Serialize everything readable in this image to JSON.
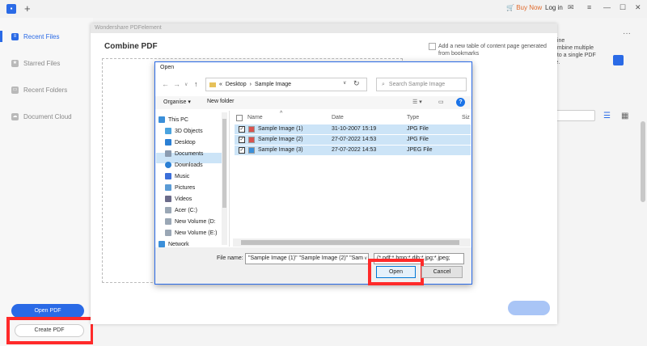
{
  "topbar": {
    "buy_now": "Buy Now",
    "login": "Log in"
  },
  "sidebar": {
    "items": [
      {
        "label": "Recent Files"
      },
      {
        "label": "Starred Files"
      },
      {
        "label": "Recent Folders"
      },
      {
        "label": "Document Cloud"
      }
    ],
    "open_pdf": "Open PDF",
    "create_pdf": "Create PDF"
  },
  "right_panel": {
    "card_text": "bine\nombine multiple\nnto a single PDF\nle."
  },
  "combine": {
    "window_title": "Wondershare PDFelement",
    "title": "Combine PDF",
    "option": "Add a new table of content page generated from bookmarks"
  },
  "open_dialog": {
    "title": "Open",
    "address": [
      "Desktop",
      "Sample Image"
    ],
    "search_placeholder": "Search Sample Image",
    "organise": "Organise",
    "new_folder": "New folder",
    "nav": [
      {
        "label": "This PC"
      },
      {
        "label": "3D Objects"
      },
      {
        "label": "Desktop"
      },
      {
        "label": "Documents"
      },
      {
        "label": "Downloads"
      },
      {
        "label": "Music"
      },
      {
        "label": "Pictures"
      },
      {
        "label": "Videos"
      },
      {
        "label": "Acer (C:)"
      },
      {
        "label": "New Volume (D:"
      },
      {
        "label": "New Volume (E:)"
      },
      {
        "label": "Network"
      }
    ],
    "columns": [
      "Name",
      "Date",
      "Type",
      "Siz"
    ],
    "files": [
      {
        "name": "Sample Image (1)",
        "date": "31-10-2007 15:19",
        "type": "JPG File"
      },
      {
        "name": "Sample Image (2)",
        "date": "27-07-2022 14:53",
        "type": "JPG File"
      },
      {
        "name": "Sample Image (3)",
        "date": "27-07-2022 14:53",
        "type": "JPEG File"
      }
    ],
    "filename_label": "File name:",
    "filename_value": "\"Sample Image (1)\" \"Sample Image (2)\" \"Sam",
    "filetype_value": "(*.pdf;*.bmp;*.dib;*.jpg;*.jpeg;",
    "open_button": "Open",
    "cancel_button": "Cancel"
  }
}
